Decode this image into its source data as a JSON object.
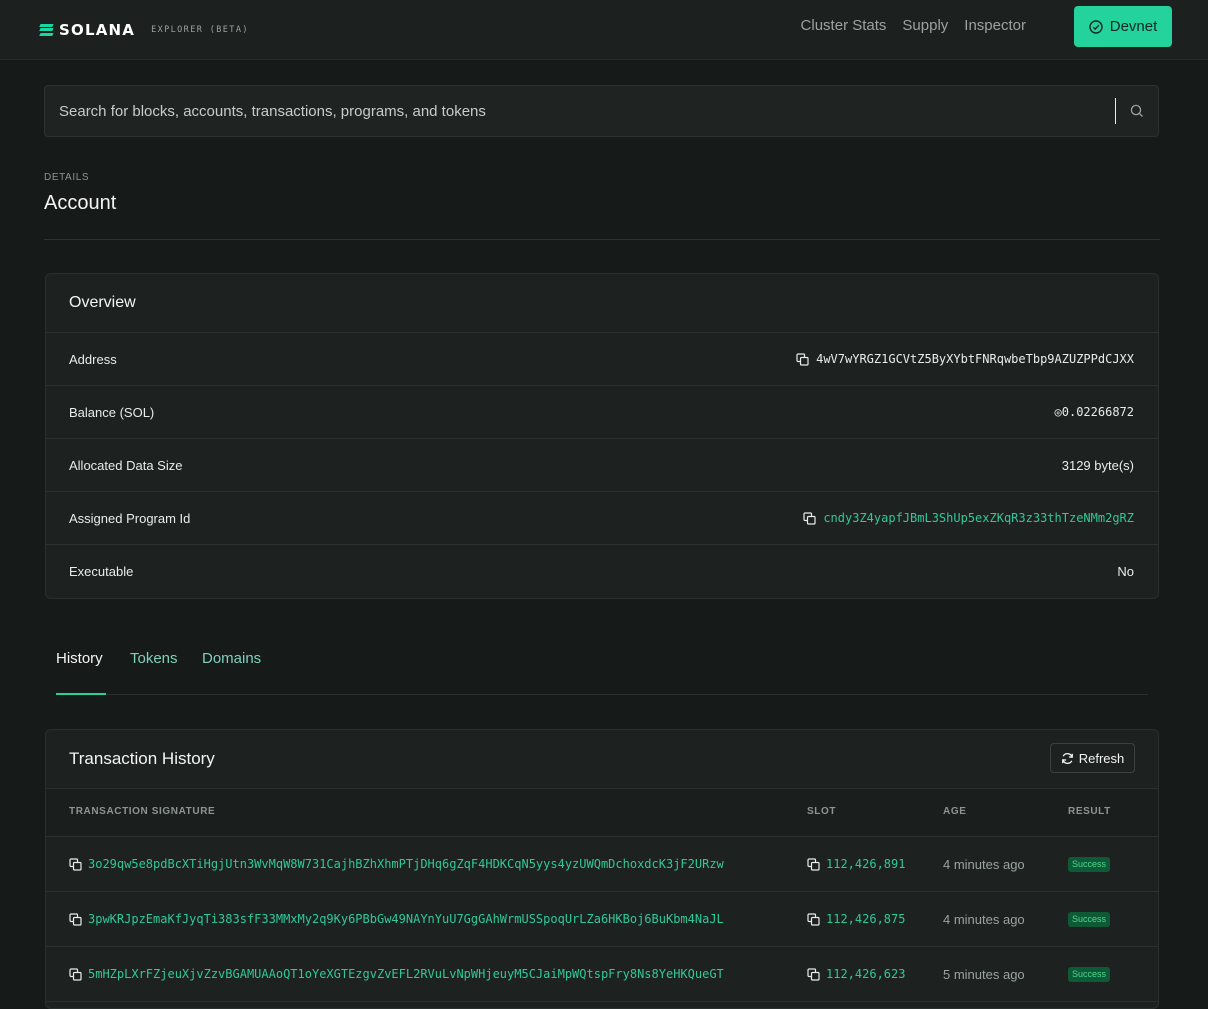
{
  "header": {
    "logo_text": "SOLANA",
    "logo_sub": "EXPLORER (BETA)",
    "nav": [
      "Cluster Stats",
      "Supply",
      "Inspector"
    ],
    "cluster_button": "Devnet"
  },
  "search": {
    "placeholder": "Search for blocks, accounts, transactions, programs, and tokens"
  },
  "page": {
    "pretitle": "DETAILS",
    "title": "Account"
  },
  "overview": {
    "title": "Overview",
    "rows": [
      {
        "label": "Address",
        "value": "4wV7wYRGZ1GCVtZ5ByXYbtFNRqwbeTbp9AZUZPPdCJXX"
      },
      {
        "label": "Balance (SOL)",
        "value": "◎0.02266872"
      },
      {
        "label": "Allocated Data Size",
        "value": "3129 byte(s)"
      },
      {
        "label": "Assigned Program Id",
        "value": "cndy3Z4yapfJBmL3ShUp5exZKqR3z33thTzeNMm2gRZ"
      },
      {
        "label": "Executable",
        "value": "No"
      }
    ]
  },
  "tabs": [
    "History",
    "Tokens",
    "Domains"
  ],
  "history": {
    "title": "Transaction History",
    "refresh_label": "Refresh",
    "columns": [
      "TRANSACTION SIGNATURE",
      "SLOT",
      "AGE",
      "RESULT"
    ],
    "rows": [
      {
        "signature": "3o29qw5e8pdBcXTiHgjUtn3WvMqW8W731CajhBZhXhmPTjDHq6gZqF4HDKCqN5yys4yzUWQmDchoxdcK3jF2URzw",
        "slot": "112,426,891",
        "age": "4 minutes ago",
        "result": "Success"
      },
      {
        "signature": "3pwKRJpzEmaKfJyqTi383sfF33MMxMy2q9Ky6PBbGw49NAYnYuU7GgGAhWrmUSSpoqUrLZa6HKBoj6BuKbm4NaJL",
        "slot": "112,426,875",
        "age": "4 minutes ago",
        "result": "Success"
      },
      {
        "signature": "5mHZpLXrFZjeuXjvZzvBGAMUAAoQT1oYeXGTEzgvZvEFL2RVuLvNpWHjeuyM5CJaiMpWQtspFry8Ns8YeHKQueGT",
        "slot": "112,426,623",
        "age": "5 minutes ago",
        "result": "Success"
      }
    ]
  },
  "colors": {
    "accent": "#24d29c",
    "link": "#2fc898",
    "success_bg": "#0f5a36",
    "success_fg": "#4bd68f",
    "background": "#161a19"
  }
}
